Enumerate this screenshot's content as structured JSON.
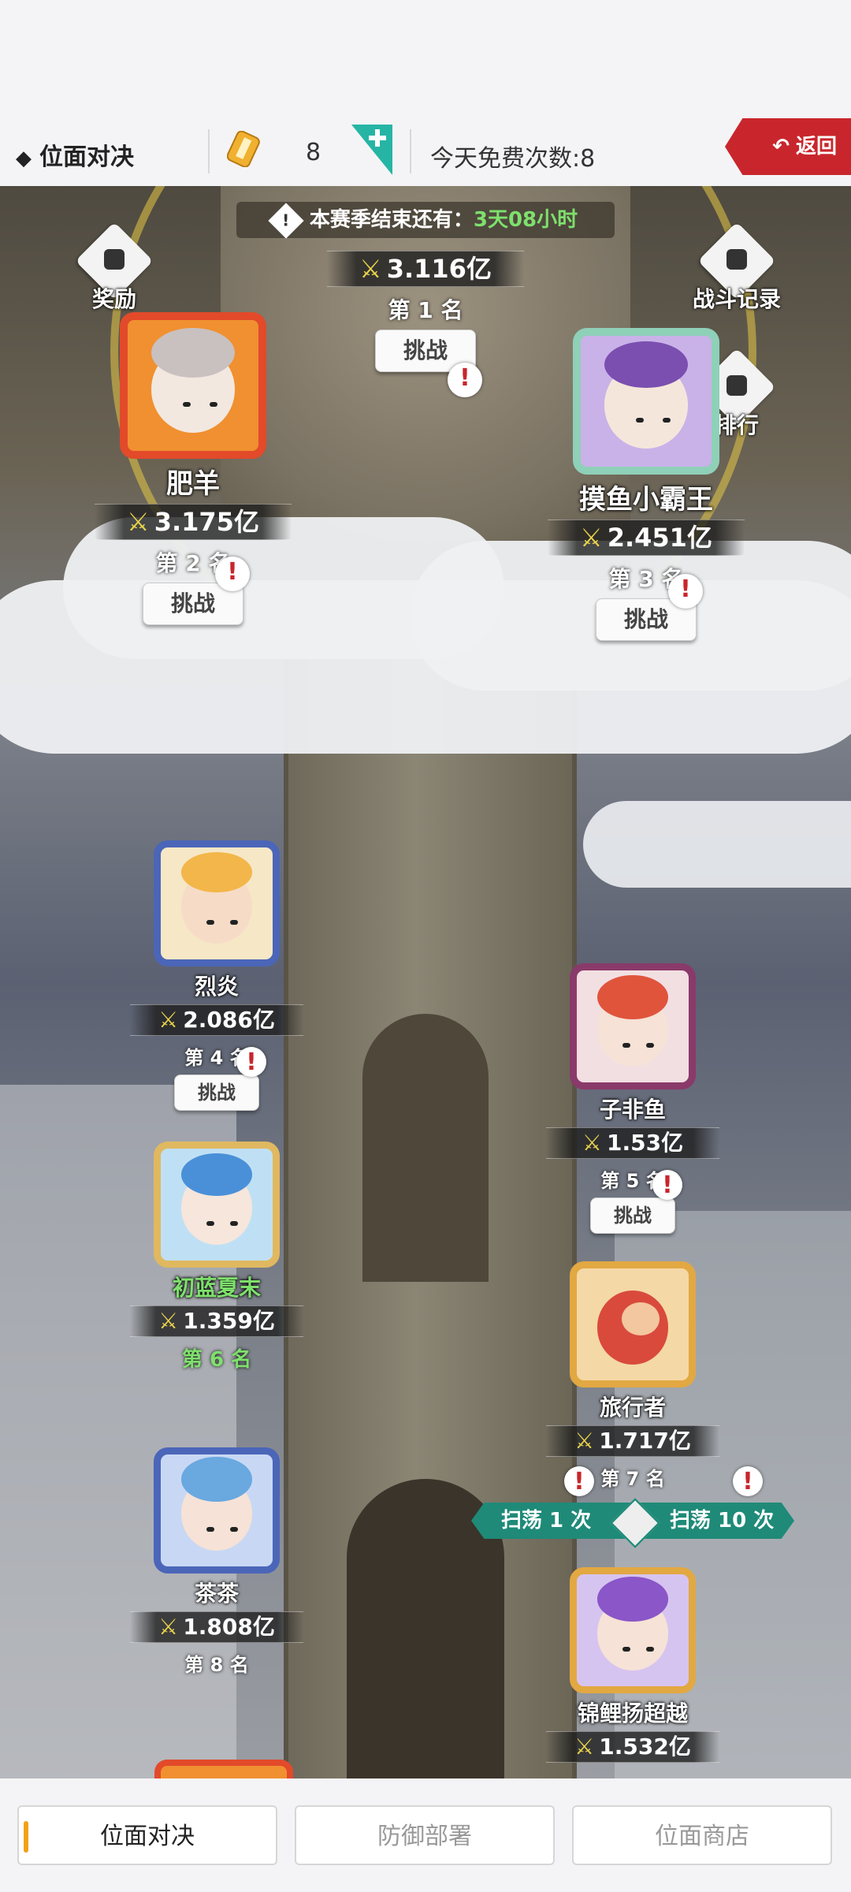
{
  "header": {
    "title": "位面对决",
    "ticket_count": "8",
    "free_text": "今天免费次数:8",
    "back_label": "返回",
    "accent": "#c8262c"
  },
  "season": {
    "prefix": "本赛季结束还有：",
    "remaining": "3天08小时"
  },
  "side_buttons": {
    "reward": "奖励",
    "battle_log": "战斗记录",
    "ranking": "排行"
  },
  "players": [
    {
      "name": "",
      "power": "3.116亿",
      "rank": "第 1 名",
      "challenge": "挑战"
    },
    {
      "name": "肥羊",
      "power": "3.175亿",
      "rank": "第 2 名",
      "challenge": "挑战"
    },
    {
      "name": "摸鱼小霸王",
      "power": "2.451亿",
      "rank": "第 3 名",
      "challenge": "挑战"
    },
    {
      "name": "烈炎",
      "power": "2.086亿",
      "rank": "第 4 名",
      "challenge": "挑战"
    },
    {
      "name": "子非鱼",
      "power": "1.53亿",
      "rank": "第 5 名",
      "challenge": "挑战"
    },
    {
      "name": "初蓝夏末",
      "power": "1.359亿",
      "rank": "第 6 名",
      "challenge": ""
    },
    {
      "name": "旅行者",
      "power": "1.717亿",
      "rank": "第 7 名",
      "challenge": ""
    },
    {
      "name": "茶茶",
      "power": "1.808亿",
      "rank": "第 8 名",
      "challenge": ""
    },
    {
      "name": "锦鲤扬超越",
      "power": "1.532亿",
      "rank": "",
      "challenge": ""
    }
  ],
  "sweep": {
    "once": "扫荡 1 次",
    "ten": "扫荡 10 次"
  },
  "tabs": [
    "位面对决",
    "防御部署",
    "位面商店"
  ],
  "icons": {
    "title": "diamond-bullet-icon",
    "ticket": "ticket-icon",
    "plus": "add-ticket-icon",
    "back": "return-arrow-icon",
    "warning": "warning-icon",
    "power": "crossed-swords-icon",
    "alert": "exclamation-bubble-icon"
  }
}
